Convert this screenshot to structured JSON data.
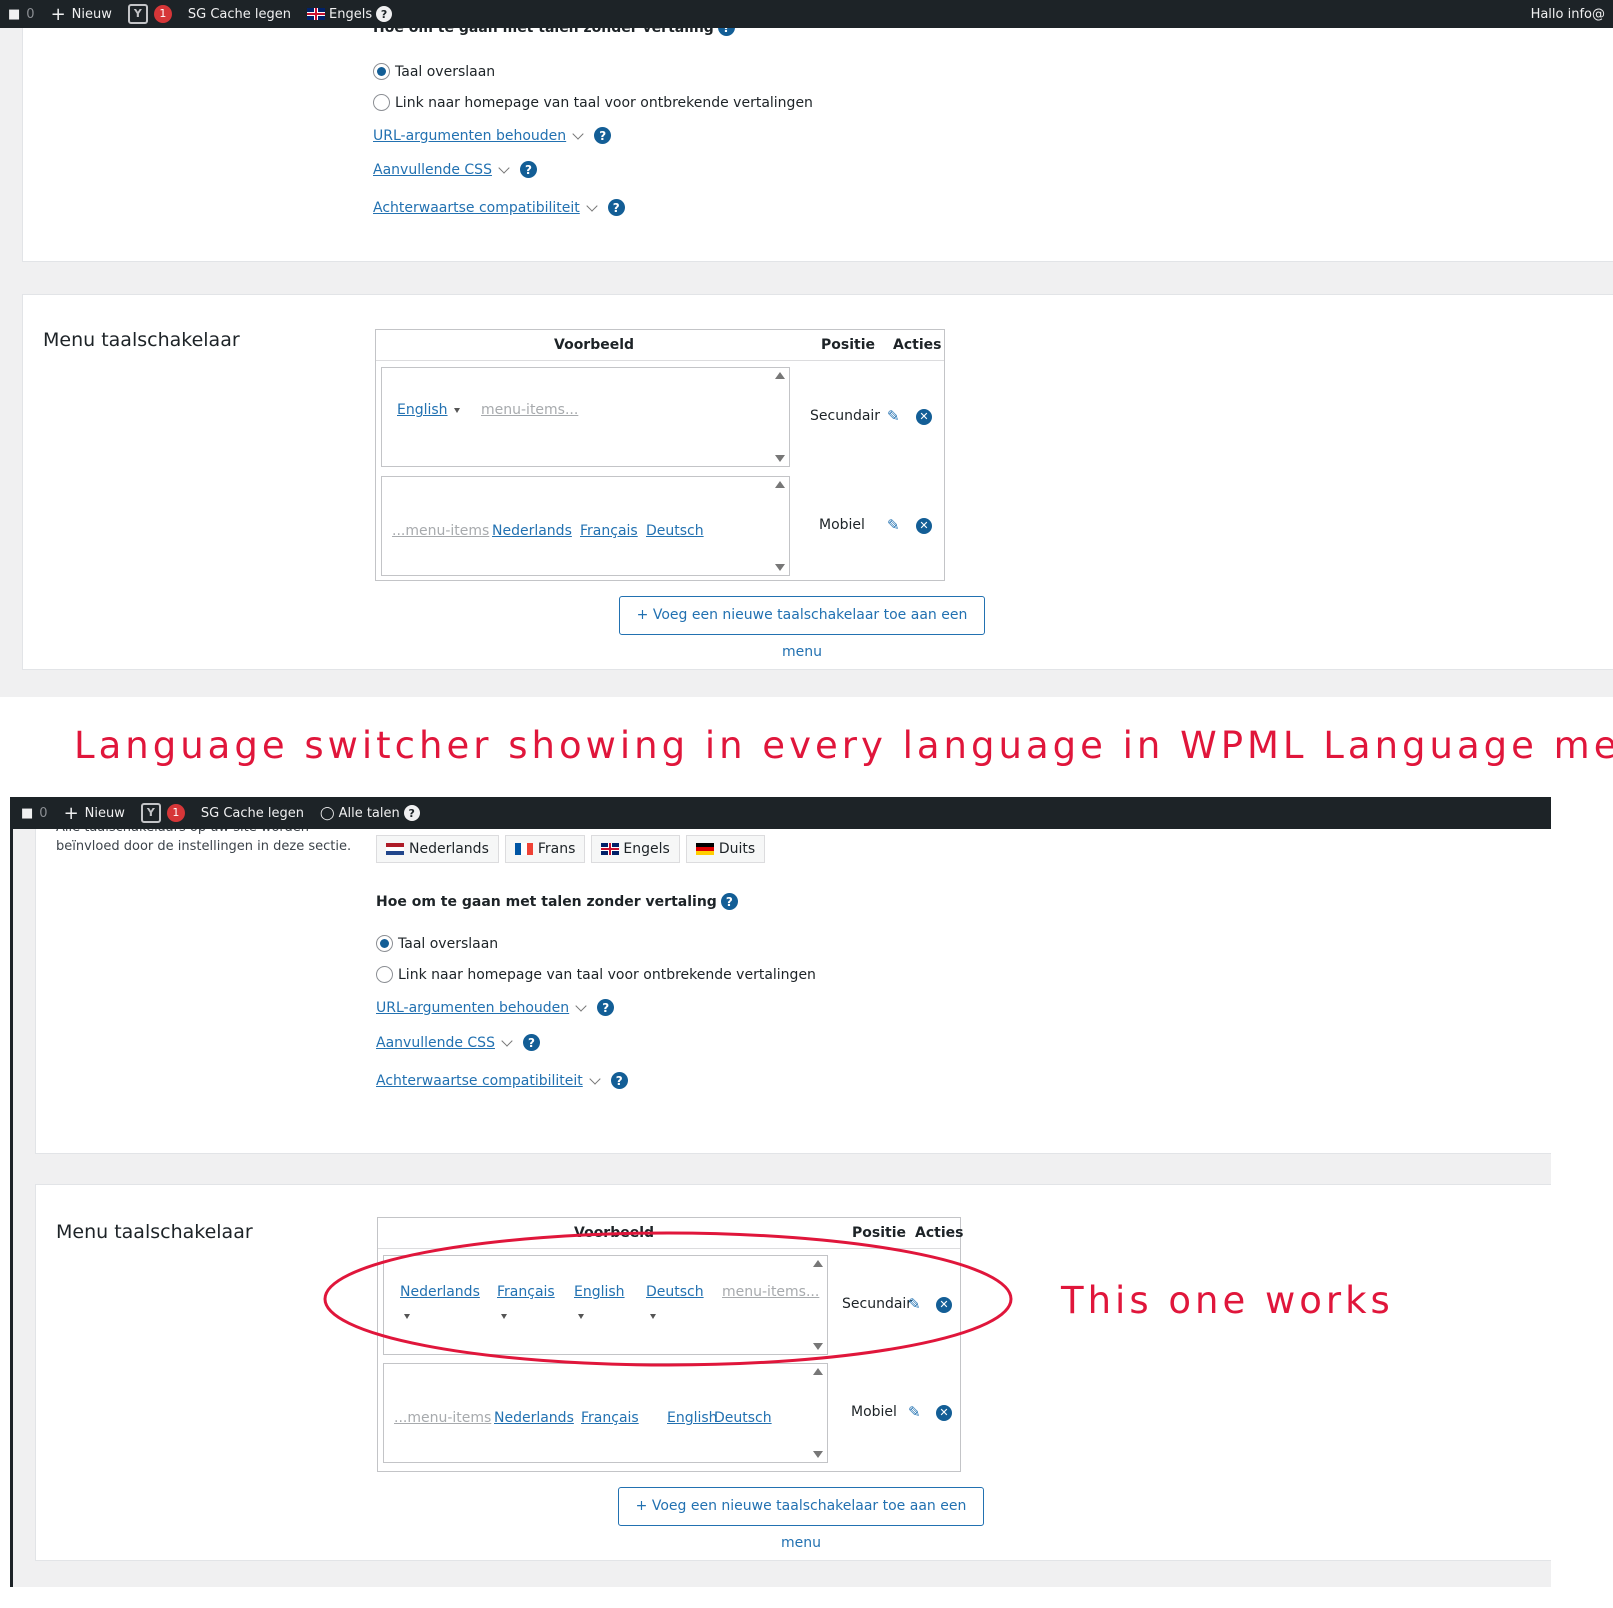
{
  "adminbar1": {
    "comments": "0",
    "new": "Nieuw",
    "yoast_badge": "1",
    "cache": "SG Cache legen",
    "language": "Engels",
    "help": "?",
    "greeting": "Hallo info@"
  },
  "adminbar2": {
    "comments": "0",
    "new": "Nieuw",
    "yoast_badge": "1",
    "cache": "SG Cache legen",
    "language": "Alle talen",
    "help": "?"
  },
  "settings1": {
    "heading": "Hoe om te gaan met talen zonder vertaling",
    "radio_skip": "Taal overslaan",
    "radio_link": "Link naar homepage van taal voor ontbrekende vertalingen",
    "url_args": "URL-argumenten behouden",
    "extra_css": "Aanvullende CSS",
    "backcompat": "Achterwaartse compatibiliteit"
  },
  "menu1": {
    "section_title": "Menu taalschakelaar",
    "col_preview": "Voorbeeld",
    "col_position": "Positie",
    "col_actions": "Acties",
    "row1": {
      "items": [
        "English",
        "menu-items..."
      ],
      "position": "Secundair"
    },
    "row2": {
      "items": [
        "...menu-items",
        "Nederlands",
        "Français",
        "Deutsch"
      ],
      "position": "Mobiel"
    },
    "add_button": "+ Voeg een nieuwe taalschakelaar toe aan een menu"
  },
  "annotation_title": "Language switcher showing in every language in WPML Language menu",
  "settings2": {
    "intro_line1": "Alle taalschakelaars op uw site worden",
    "intro_line2": "beïnvloed door de instellingen in deze sectie.",
    "languages": [
      "Nederlands",
      "Frans",
      "Engels",
      "Duits"
    ],
    "heading": "Hoe om te gaan met talen zonder vertaling",
    "radio_skip": "Taal overslaan",
    "radio_link": "Link naar homepage van taal voor ontbrekende vertalingen",
    "url_args": "URL-argumenten behouden",
    "extra_css": "Aanvullende CSS",
    "backcompat": "Achterwaartse compatibiliteit"
  },
  "menu2": {
    "section_title": "Menu taalschakelaar",
    "col_preview": "Voorbeeld",
    "col_position": "Positie",
    "col_actions": "Acties",
    "row1": {
      "items": [
        "Nederlands",
        "Français",
        "English",
        "Deutsch",
        "menu-items..."
      ],
      "position": "Secundair"
    },
    "row2": {
      "items": [
        "...menu-items",
        "Nederlands",
        "Français",
        "English",
        "Deutsch"
      ],
      "position": "Mobiel"
    },
    "add_button": "+ Voeg een nieuwe taalschakelaar toe aan een menu"
  },
  "annotation_works": "This one works",
  "colors": {
    "accent": "#2271b1",
    "annotation": "#e0163b",
    "adminbar": "#1d2327"
  }
}
